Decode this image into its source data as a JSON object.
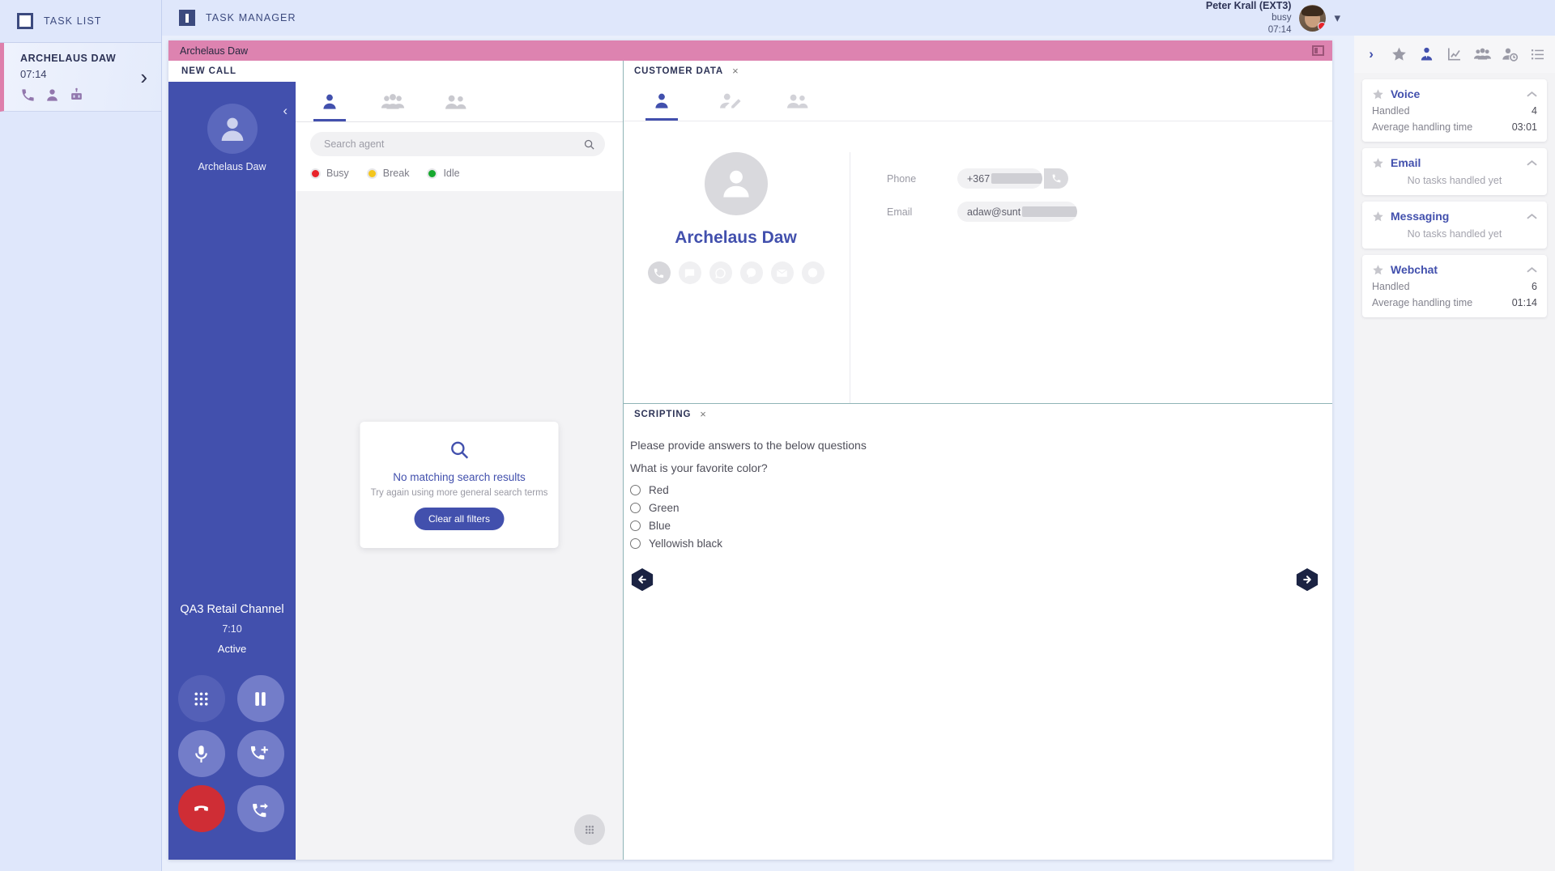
{
  "header": {
    "task_list_label": "TASK LIST",
    "task_manager_label": "TASK MANAGER",
    "user": {
      "name": "Peter Krall (EXT3)",
      "status": "busy",
      "timer": "07:14",
      "status_color": "#e8232a"
    }
  },
  "task_list": {
    "item": {
      "name": "ARCHELAUS DAW",
      "time": "07:14"
    }
  },
  "task_panel": {
    "title": "Archelaus Daw",
    "new_call_label": "NEW CALL"
  },
  "call": {
    "agent_name": "Archelaus Daw",
    "channel": "QA3 Retail Channel",
    "timer": "7:10",
    "state": "Active"
  },
  "agents": {
    "search_placeholder": "Search agent",
    "search_value": "",
    "legend": [
      {
        "label": "Busy",
        "color": "#e8232a"
      },
      {
        "label": "Break",
        "color": "#f4c61e"
      },
      {
        "label": "Idle",
        "color": "#17a82e"
      }
    ],
    "empty": {
      "title": "No matching search results",
      "subtitle": "Try again using more general search terms",
      "button": "Clear all filters"
    }
  },
  "customer": {
    "tab_label": "CUSTOMER DATA",
    "name": "Archelaus Daw",
    "phone_label": "Phone",
    "phone_value": "+367",
    "email_label": "Email",
    "email_value": "adaw@sunt"
  },
  "scripting": {
    "tab_label": "SCRIPTING",
    "intro": "Please provide answers to the below questions",
    "question": "What is your favorite color?",
    "options": [
      "Red",
      "Green",
      "Blue",
      "Yellowish black"
    ]
  },
  "stats": {
    "handled_label": "Handled",
    "aht_label": "Average handling time",
    "empty_label": "No tasks handled yet",
    "cards": [
      {
        "title": "Voice",
        "handled": "4",
        "aht": "03:01",
        "empty": false
      },
      {
        "title": "Email",
        "handled": "",
        "aht": "",
        "empty": true
      },
      {
        "title": "Messaging",
        "handled": "",
        "aht": "",
        "empty": true
      },
      {
        "title": "Webchat",
        "handled": "6",
        "aht": "01:14",
        "empty": false
      }
    ]
  },
  "colors": {
    "accent": "#4250ad",
    "pink": "#dd83b0",
    "header_bg": "#dfe7fb"
  }
}
